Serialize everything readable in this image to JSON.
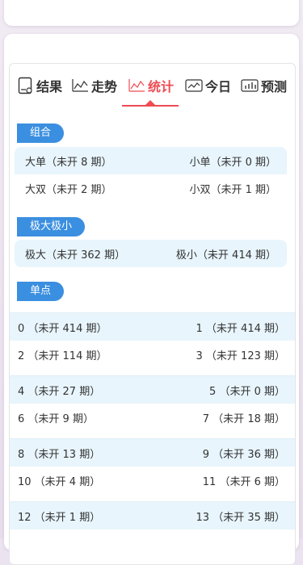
{
  "tabs": [
    {
      "label": "结果",
      "icon": "result-icon"
    },
    {
      "label": "走势",
      "icon": "trend-icon"
    },
    {
      "label": "统计",
      "icon": "stats-icon",
      "active": true
    },
    {
      "label": "今日",
      "icon": "today-icon"
    },
    {
      "label": "预测",
      "icon": "predict-icon"
    }
  ],
  "sections": {
    "combo": {
      "title": "组合",
      "rows": [
        {
          "left": "大单（未开 8 期）",
          "right": "小单（未开 0 期）"
        },
        {
          "left": "大双（未开 2 期）",
          "right": "小双（未开 1 期）"
        }
      ]
    },
    "extreme": {
      "title": "极大极小",
      "rows": [
        {
          "left": "极大（未开 362 期）",
          "right": "极小（未开 414 期）"
        }
      ]
    },
    "single": {
      "title": "单点",
      "rows": [
        {
          "left": "0 （未开 414 期）",
          "right": "1 （未开 414 期）"
        },
        {
          "left": "2 （未开 114 期）",
          "right": "3 （未开 123 期）"
        },
        {
          "left": "4 （未开 27 期）",
          "right": "5 （未开 0 期）"
        },
        {
          "left": "6 （未开 9 期）",
          "right": "7 （未开 18 期）"
        },
        {
          "left": "8 （未开 13 期）",
          "right": "9 （未开 36 期）"
        },
        {
          "left": "10 （未开 4 期）",
          "right": "11 （未开 6 期）"
        },
        {
          "left": "12 （未开 1 期）",
          "right": "13 （未开 35 期）"
        }
      ]
    }
  },
  "colors": {
    "accent": "#ef4b52",
    "pill": "#3b8fe0",
    "teal": "#19b3b1",
    "ball_red": "#e0141e",
    "ball_blue": "#1a1adf"
  }
}
